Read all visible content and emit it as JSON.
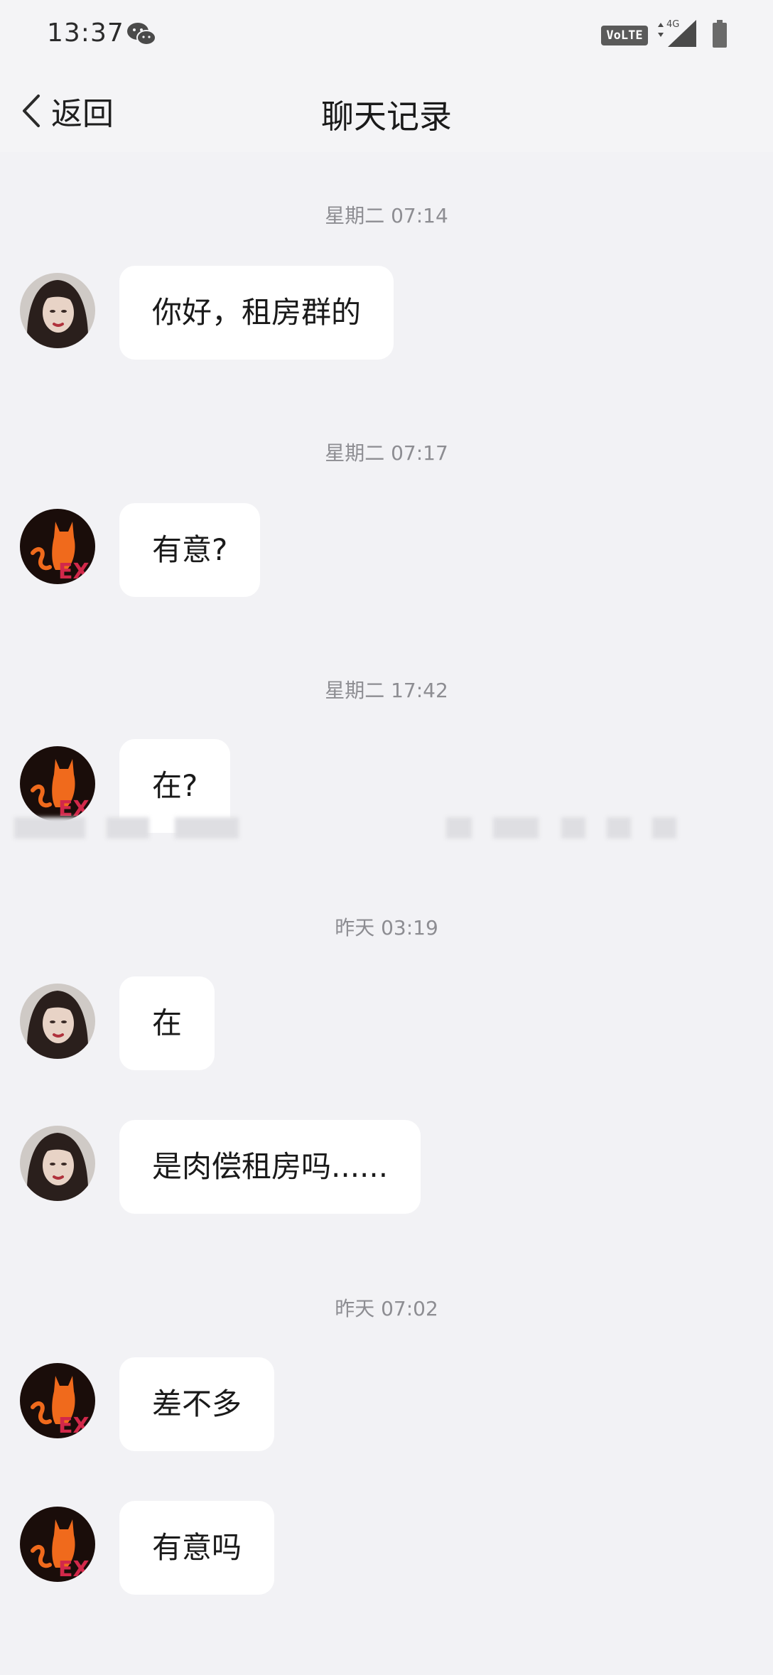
{
  "status_bar": {
    "time": "13:37",
    "volte": "VoLTE",
    "network": "4G",
    "icons": [
      "wechat-icon",
      "signal-icon",
      "battery-icon"
    ]
  },
  "nav": {
    "back_label": "返回",
    "title": "聊天记录"
  },
  "messages": {
    "ts1": "星期二 07:14",
    "m1": "你好，租房群的",
    "ts2": "星期二 07:17",
    "m2": "有意?",
    "ts3": "星期二 17:42",
    "m3": "在?",
    "ts4": "昨天 03:19",
    "m4": "在",
    "m5": "是肉偿租房吗......",
    "ts5": "昨天 07:02",
    "m6": "差不多",
    "m7": "有意吗"
  },
  "colors": {
    "background": "#f2f2f5",
    "bubble": "#ffffff",
    "timestamp": "#8d8d92",
    "cat_avatar_bg": "#1a0d0a",
    "cat_orange": "#f06a1c"
  }
}
